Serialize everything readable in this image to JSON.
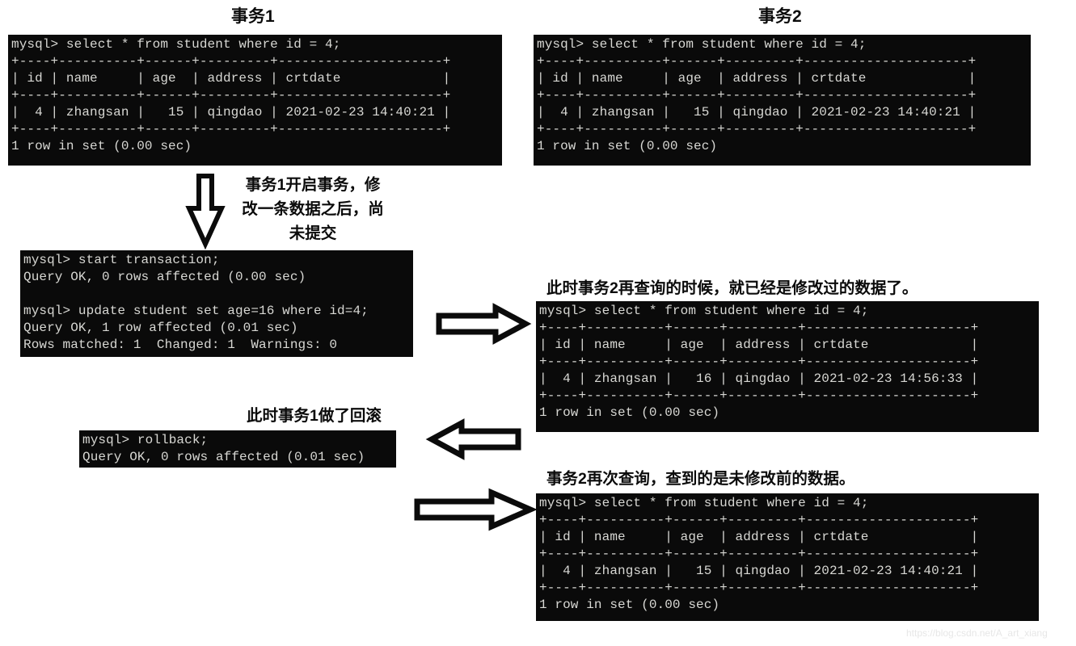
{
  "titles": {
    "tx1": "事务1",
    "tx2": "事务2"
  },
  "notes": {
    "step1": "事务1开启事务，修\n改一条数据之后，尚\n未提交",
    "step2": "此时事务2再查询的时候，就已经是修改过的数据了。",
    "step3": "此时事务1做了回滚",
    "step4": "事务2再次查询，查到的是未修改前的数据。"
  },
  "terminals": {
    "tx1_select": {
      "lines": [
        "mysql> select * from student where id = 4;",
        "+----+----------+------+---------+---------------------+",
        "| id | name     | age  | address | crtdate             |",
        "+----+----------+------+---------+---------------------+",
        "|  4 | zhangsan |   15 | qingdao | 2021-02-23 14:40:21 |",
        "+----+----------+------+---------+---------------------+",
        "1 row in set (0.00 sec)"
      ]
    },
    "tx2_select": {
      "lines": [
        "mysql> select * from student where id = 4;",
        "+----+----------+------+---------+---------------------+",
        "| id | name     | age  | address | crtdate             |",
        "+----+----------+------+---------+---------------------+",
        "|  4 | zhangsan |   15 | qingdao | 2021-02-23 14:40:21 |",
        "+----+----------+------+---------+---------------------+",
        "1 row in set (0.00 sec)"
      ]
    },
    "tx1_update": {
      "lines": [
        "mysql> start transaction;",
        "Query OK, 0 rows affected (0.00 sec)",
        "",
        "mysql> update student set age=16 where id=4;",
        "Query OK, 1 row affected (0.01 sec)",
        "Rows matched: 1  Changed: 1  Warnings: 0"
      ]
    },
    "tx2_select_dirty": {
      "lines": [
        "mysql> select * from student where id = 4;",
        "+----+----------+------+---------+---------------------+",
        "| id | name     | age  | address | crtdate             |",
        "+----+----------+------+---------+---------------------+",
        "|  4 | zhangsan |   16 | qingdao | 2021-02-23 14:56:33 |",
        "+----+----------+------+---------+---------------------+",
        "1 row in set (0.00 sec)"
      ]
    },
    "tx1_rollback": {
      "lines": [
        "mysql> rollback;",
        "Query OK, 0 rows affected (0.01 sec)"
      ]
    },
    "tx2_select_after": {
      "lines": [
        "mysql> select * from student where id = 4;",
        "+----+----------+------+---------+---------------------+",
        "| id | name     | age  | address | crtdate             |",
        "+----+----------+------+---------+---------------------+",
        "|  4 | zhangsan |   15 | qingdao | 2021-02-23 14:40:21 |",
        "+----+----------+------+---------+---------------------+",
        "1 row in set (0.00 sec)"
      ]
    }
  },
  "table_data": {
    "columns": [
      "id",
      "name",
      "age",
      "address",
      "crtdate"
    ],
    "rows_before": [
      [
        "4",
        "zhangsan",
        "15",
        "qingdao",
        "2021-02-23 14:40:21"
      ]
    ],
    "rows_dirty": [
      [
        "4",
        "zhangsan",
        "16",
        "qingdao",
        "2021-02-23 14:56:33"
      ]
    ],
    "result_footer": "1 row in set (0.00 sec)"
  },
  "watermark": "https://blog.csdn.net/A_art_xiang",
  "colors": {
    "terminal_bg": "#0a0a0a",
    "terminal_fg": "#d8d8d4",
    "text": "#0b0b0b",
    "watermark": "#e7e7e7"
  }
}
